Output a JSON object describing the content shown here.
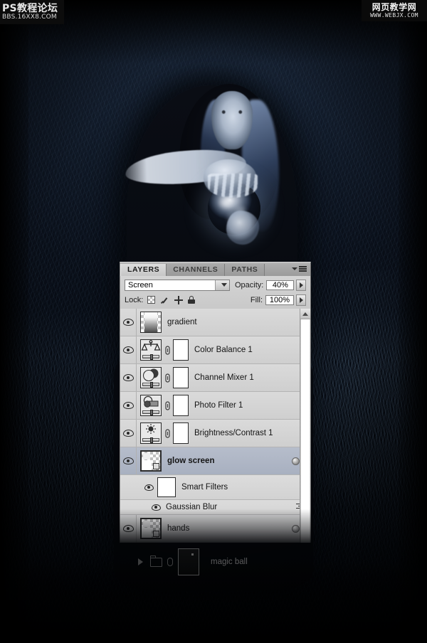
{
  "watermarks": {
    "left_title": "PS教程论坛",
    "left_url": "BBS.16XX8.COM",
    "right_title": "网页教学网",
    "right_url": "WWW.WEBJX.COM"
  },
  "panel": {
    "tabs": [
      {
        "label": "LAYERS",
        "active": true
      },
      {
        "label": "CHANNELS",
        "active": false
      },
      {
        "label": "PATHS",
        "active": false
      }
    ],
    "menu_icon": "panel-menu-icon",
    "blend_mode": {
      "value": "Screen",
      "dropdown_icon": "chevron-down-icon"
    },
    "opacity": {
      "label": "Opacity:",
      "value": "40%",
      "stepper_icon": "triangle-right-icon"
    },
    "fill": {
      "label": "Fill:",
      "value": "100%",
      "stepper_icon": "triangle-right-icon"
    },
    "lock": {
      "label": "Lock:",
      "icons": [
        "lock-transparent-pixels-icon",
        "lock-image-pixels-icon",
        "lock-position-icon",
        "lock-all-icon"
      ]
    },
    "scrollbar": {
      "up_arrow_icon": "scroll-up-arrow-icon"
    },
    "layers": [
      {
        "name": "gradient",
        "type": "pixel",
        "visible": true,
        "selected": false,
        "thumb": "gradient-thumbnail",
        "has_mask": false,
        "has_link": false,
        "eye_icon": "eye-icon"
      },
      {
        "name": "Color Balance 1",
        "type": "adjustment",
        "visible": true,
        "selected": false,
        "thumb": "color-balance-icon",
        "has_mask": true,
        "has_link": true,
        "eye_icon": "eye-icon"
      },
      {
        "name": "Channel Mixer 1",
        "type": "adjustment",
        "visible": true,
        "selected": false,
        "thumb": "channel-mixer-icon",
        "has_mask": true,
        "has_link": true,
        "eye_icon": "eye-icon"
      },
      {
        "name": "Photo Filter 1",
        "type": "adjustment",
        "visible": true,
        "selected": false,
        "thumb": "photo-filter-icon",
        "has_mask": true,
        "has_link": true,
        "eye_icon": "eye-icon"
      },
      {
        "name": "Brightness/Contrast 1",
        "type": "adjustment",
        "visible": true,
        "selected": false,
        "thumb": "brightness-contrast-icon",
        "has_mask": true,
        "has_link": true,
        "eye_icon": "eye-icon"
      },
      {
        "name": "glow screen",
        "type": "smart-object",
        "visible": true,
        "selected": true,
        "thumb": "smart-object-thumbnail",
        "has_mask": false,
        "has_link": false,
        "eye_icon": "eye-icon",
        "fx_icon": "smart-object-badge-icon",
        "collapse_icon": "caret-up-icon"
      }
    ],
    "smart_filters": {
      "label": "Smart Filters",
      "eye_icon": "eye-icon",
      "mask_thumb": "filter-mask-thumbnail",
      "entries": [
        {
          "label": "Gaussian Blur",
          "eye_icon": "eye-icon",
          "settings_icon": "filter-settings-icon"
        }
      ]
    },
    "hands_layer": {
      "name": "hands",
      "visible": true,
      "thumb": "smart-object-thumbnail",
      "eye_icon": "eye-icon",
      "fx_icon": "smart-object-badge-icon",
      "expand_icon": "caret-down-icon"
    }
  },
  "ghost_row": {
    "name": "magic ball",
    "expand_icon": "triangle-right-icon",
    "folder_icon": "folder-icon",
    "link_icon": "link-icon",
    "thumb": "group-thumbnail"
  }
}
